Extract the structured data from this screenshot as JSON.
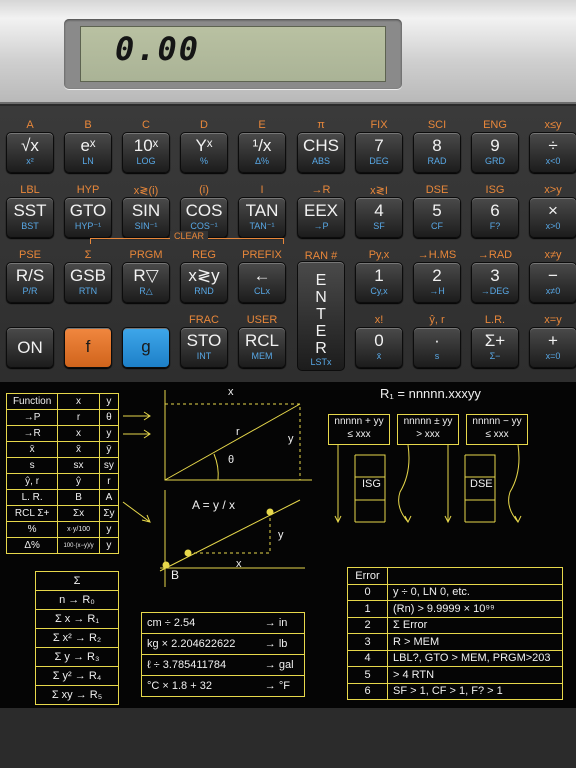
{
  "display": {
    "value": "0.00"
  },
  "keys": [
    {
      "top": "A",
      "main": "√x",
      "sub": "x²"
    },
    {
      "top": "B",
      "main": "eˣ",
      "sub": "LN"
    },
    {
      "top": "C",
      "main": "10ˣ",
      "sub": "LOG"
    },
    {
      "top": "D",
      "main": "Yˣ",
      "sub": "%"
    },
    {
      "top": "E",
      "main": "¹/x",
      "sub": "Δ%"
    },
    {
      "top": "π",
      "main": "CHS",
      "sub": "ABS"
    },
    {
      "top": "FIX",
      "main": "7",
      "sub": "DEG"
    },
    {
      "top": "SCI",
      "main": "8",
      "sub": "RAD"
    },
    {
      "top": "ENG",
      "main": "9",
      "sub": "GRD"
    },
    {
      "top": "x≤y",
      "main": "÷",
      "sub": "x<0"
    },
    {
      "top": "LBL",
      "main": "SST",
      "sub": "BST"
    },
    {
      "top": "HYP",
      "main": "GTO",
      "sub": "HYP⁻¹"
    },
    {
      "top": "x≷(i)",
      "main": "SIN",
      "sub": "SIN⁻¹"
    },
    {
      "top": "(i)",
      "main": "COS",
      "sub": "COS⁻¹"
    },
    {
      "top": "I",
      "main": "TAN",
      "sub": "TAN⁻¹"
    },
    {
      "top": "→R",
      "main": "EEX",
      "sub": "→P"
    },
    {
      "top": "x≷I",
      "main": "4",
      "sub": "SF"
    },
    {
      "top": "DSE",
      "main": "5",
      "sub": "CF"
    },
    {
      "top": "ISG",
      "main": "6",
      "sub": "F?"
    },
    {
      "top": "x>y",
      "main": "×",
      "sub": "x>0"
    },
    {
      "top": "PSE",
      "main": "R/S",
      "sub": "P/R"
    },
    {
      "top": "Σ",
      "main": "GSB",
      "sub": "RTN"
    },
    {
      "top": "PRGM",
      "main": "R▽",
      "sub": "R△"
    },
    {
      "top": "REG",
      "main": "x≷y",
      "sub": "RND"
    },
    {
      "top": "PREFIX",
      "main": "←",
      "sub": "CLx"
    },
    {
      "top": "Py,x",
      "main": "1",
      "sub": "Cy,x"
    },
    {
      "top": "→H.MS",
      "main": "2",
      "sub": "→H"
    },
    {
      "top": "→RAD",
      "main": "3",
      "sub": "→DEG"
    },
    {
      "top": "x≠y",
      "main": "−",
      "sub": "x≠0"
    },
    {
      "top": "",
      "main": "ON",
      "sub": ""
    },
    {
      "top": "",
      "main": "f",
      "sub": ""
    },
    {
      "top": "",
      "main": "g",
      "sub": ""
    },
    {
      "top": "FRAC",
      "main": "STO",
      "sub": "INT"
    },
    {
      "top": "USER",
      "main": "RCL",
      "sub": "MEM"
    },
    {
      "top": "x!",
      "main": "0",
      "sub": "x̄"
    },
    {
      "top": "ŷ, r",
      "main": "·",
      "sub": "s"
    },
    {
      "top": "L.R.",
      "main": "Σ+",
      "sub": "Σ−"
    },
    {
      "top": "x=y",
      "main": "+",
      "sub": "x=0"
    }
  ],
  "enter": {
    "top": "RAN #",
    "letters": [
      "E",
      "N",
      "T",
      "E",
      "R"
    ],
    "sub": "LSTx"
  },
  "clear_label": "CLEAR",
  "functions": {
    "header": [
      "Function",
      "x",
      "y"
    ],
    "rows": [
      [
        "→P",
        "r",
        "θ"
      ],
      [
        "→R",
        "x",
        "y"
      ],
      [
        "x̄",
        "x̄",
        "ȳ"
      ],
      [
        "s",
        "sx",
        "sy"
      ],
      [
        "ŷ, r",
        "ŷ",
        "r"
      ],
      [
        "L. R.",
        "B",
        "A"
      ],
      [
        "RCL Σ+",
        "Σx",
        "Σy"
      ],
      [
        "%",
        "x·y/100",
        "y"
      ],
      [
        "Δ%",
        "100·(x−y)/y",
        "y"
      ]
    ]
  },
  "diagram": {
    "x": "x",
    "y": "y",
    "r": "r",
    "theta": "θ",
    "formula": "A = y / x",
    "b": "B",
    "x2": "x",
    "y2": "y"
  },
  "loop": {
    "title": "R₁ = nnnnn.xxxyy",
    "box1a": "nnnnn + yy",
    "box1b": "≤ xxx",
    "box2a": "nnnnn ± yy",
    "box2b": "> xxx",
    "box3a": "nnnnn − yy",
    "box3b": "≤ xxx",
    "isg": "ISG",
    "dse": "DSE"
  },
  "sums": [
    "Σ",
    "n → R₀",
    "Σ x → R₁",
    "Σ x² → R₂",
    "Σ y → R₃",
    "Σ y² → R₄",
    "Σ xy → R₅"
  ],
  "conversions": [
    [
      "cm ÷ 2.54",
      "→ in"
    ],
    [
      "kg × 2.204622622",
      "→ lb"
    ],
    [
      "ℓ ÷ 3.785411784",
      "→ gal"
    ],
    [
      "°C × 1.8 + 32",
      "→ °F"
    ]
  ],
  "errors": {
    "header": "Error",
    "rows": [
      [
        "0",
        "y ÷ 0, LN 0, etc."
      ],
      [
        "1",
        "(Rn) > 9.9999 × 10⁹⁹"
      ],
      [
        "2",
        "Σ Error"
      ],
      [
        "3",
        "R > MEM"
      ],
      [
        "4",
        "LBL?, GTO > MEM, PRGM>203"
      ],
      [
        "5",
        "> 4 RTN"
      ],
      [
        "6",
        "SF > 1, CF > 1, F? > 1"
      ]
    ]
  }
}
